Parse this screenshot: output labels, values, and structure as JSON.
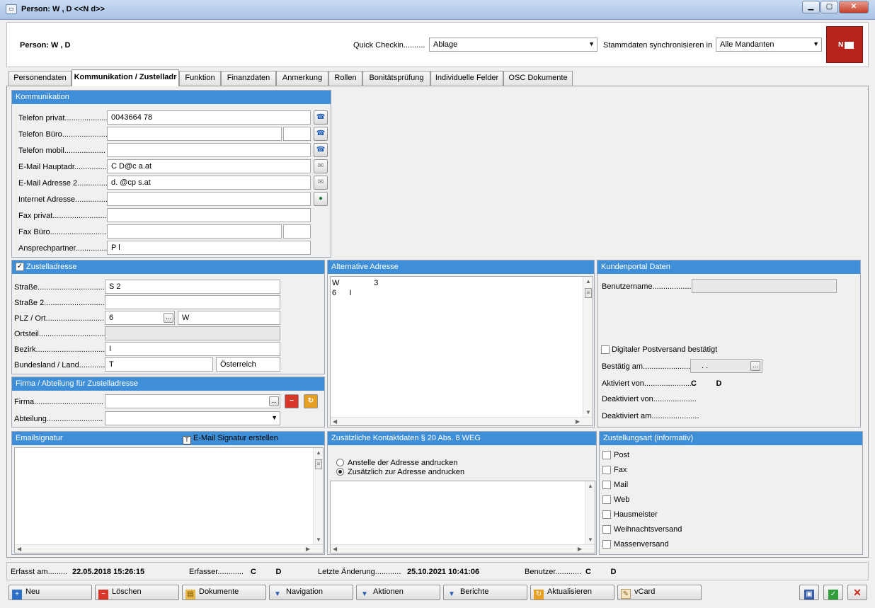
{
  "window": {
    "title": "Person: W        , D                  <<N                    d>>"
  },
  "header": {
    "person_label": "Person: W        , D",
    "quick_checkin_label": "Quick Checkin..........",
    "quick_checkin_value": "Ablage",
    "sync_label": "Stammdaten synchronisieren in",
    "sync_value": "Alle Mandanten",
    "logo_text": "N"
  },
  "tabs": [
    {
      "label": "Personendaten"
    },
    {
      "label": "Kommunikation / Zustelladr"
    },
    {
      "label": "Funktion"
    },
    {
      "label": "Finanzdaten"
    },
    {
      "label": "Anmerkung"
    },
    {
      "label": "Rollen"
    },
    {
      "label": "Bonitätsprüfung"
    },
    {
      "label": "Individuelle Felder"
    },
    {
      "label": "OSC Dokumente"
    }
  ],
  "kommunikation": {
    "title": "Kommunikation",
    "rows": [
      {
        "label": "Telefon privat....................",
        "value": "0043664            78"
      },
      {
        "label": "Telefon Büro......................",
        "value": "",
        "extra": ""
      },
      {
        "label": "Telefon mobil...................",
        "value": ""
      },
      {
        "label": "E-Mail Hauptadr...............",
        "value": "C         D@c           a.at"
      },
      {
        "label": "E-Mail Adresse 2..............",
        "value": "d.          @cp           s.at"
      },
      {
        "label": "Internet Adresse...............",
        "value": ""
      },
      {
        "label": "Fax privat...........................",
        "value": ""
      },
      {
        "label": "Fax Büro..............................",
        "value": "",
        "extra": ""
      },
      {
        "label": "Ansprechpartner................",
        "value": "P        l"
      }
    ]
  },
  "zustelladresse": {
    "title": "Zustelladresse",
    "checked": true,
    "strasse_label": "Straße.................................",
    "strasse": "S                    2",
    "strasse2_label": "Straße 2..............................",
    "strasse2": "",
    "plz_label": "PLZ / Ort.............................",
    "plz": "6",
    "ort": "W",
    "ortsteil_label": "Ortsteil................................",
    "ortsteil": "",
    "bezirk_label": "Bezirk..................................",
    "bezirk": "I",
    "bundesland_label": "Bundesland / Land..............",
    "bundesland": "T",
    "land": "Österreich"
  },
  "firma": {
    "title": "Firma / Abteilung für Zustelladresse",
    "firma_label": "Firma................................",
    "firma": "",
    "abteilung_label": "Abteilung..........................",
    "abteilung": ""
  },
  "alternative": {
    "title": "Alternative Adresse",
    "line1": "W                3",
    "line2": "6      I"
  },
  "kundenportal": {
    "title": "Kundenportal Daten",
    "benutzer_label": "Benutzername..................",
    "benutzer": "",
    "postversand_label": "Digitaler Postversand bestätigt",
    "bestaetig_label": "Bestätig am.........................",
    "bestaetig_value": ".  .",
    "aktiviert_label": "Aktiviert von........................",
    "aktiviert_value": "C         D",
    "deaktiviert_von_label": "Deaktiviert von....................",
    "deaktiviert_am_label": "Deaktiviert am......................"
  },
  "emailsignatur": {
    "title": "Emailsignatur",
    "create_label": "E-Mail Signatur erstellen"
  },
  "zusaetzlich": {
    "title": "Zusätzliche Kontaktdaten § 20 Abs. 8 WEG",
    "option1": "Anstelle der Adresse andrucken",
    "option2": "Zusätzlich zur Adresse andrucken",
    "selected": 2
  },
  "zustellungsart": {
    "title": "Zustellungsart (informativ)",
    "items": [
      "Post",
      "Fax",
      "Mail",
      "Web",
      "Hausmeister",
      "Weihnachtsversand",
      "Massenversand"
    ]
  },
  "status": {
    "erfasst_label": "Erfasst am.........",
    "erfasst_value": "22.05.2018 15:26:15",
    "erfasser_label": "Erfasser............",
    "erfasser_value": "C         D",
    "aenderung_label": "Letzte Änderung............",
    "aenderung_value": "25.10.2021 10:41:06",
    "benutzer_label": "Benutzer............",
    "benutzer_value": "C         D"
  },
  "toolbar": {
    "neu": "Neu",
    "loeschen": "Löschen",
    "dokumente": "Dokumente",
    "navigation": "Navigation",
    "aktionen": "Aktionen",
    "berichte": "Berichte",
    "aktualisieren": "Aktualisieren",
    "vcard": "vCard"
  },
  "colors": {
    "panel_header": "#3f8fd8",
    "logo": "#b8231b",
    "ok": "#2f9e3a",
    "cancel": "#d02a1e"
  }
}
